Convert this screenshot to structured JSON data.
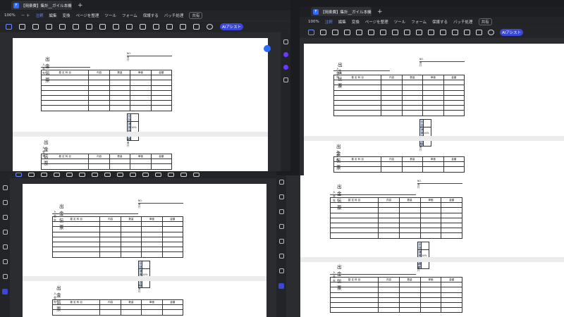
{
  "tab_title": "【岡楽費】集計__ガイル本機一",
  "tab_title_right": "【岡楽費】集計__ガイル本機一",
  "zoom": "100%",
  "menus": [
    "注釈",
    "編集",
    "変換",
    "ページを整理",
    "ツール",
    "フォーム",
    "保護する",
    "バッチ処理"
  ],
  "share_label": "共有",
  "ai_label": "AIアシスト",
  "doc": {
    "title": "出金伝票",
    "payee_label": "入金先",
    "no_label": "NO.",
    "date_label": "発行",
    "headers": [
      "勘 定 科 目",
      "内容",
      "数量",
      "単価",
      "金額"
    ],
    "subtotal": "小計",
    "tax": "消費税",
    "tax_rate": "10%",
    "total": "合計"
  },
  "colors": {
    "accent": "#2f6bff",
    "sum_label_bg": "#c8d6f0"
  }
}
